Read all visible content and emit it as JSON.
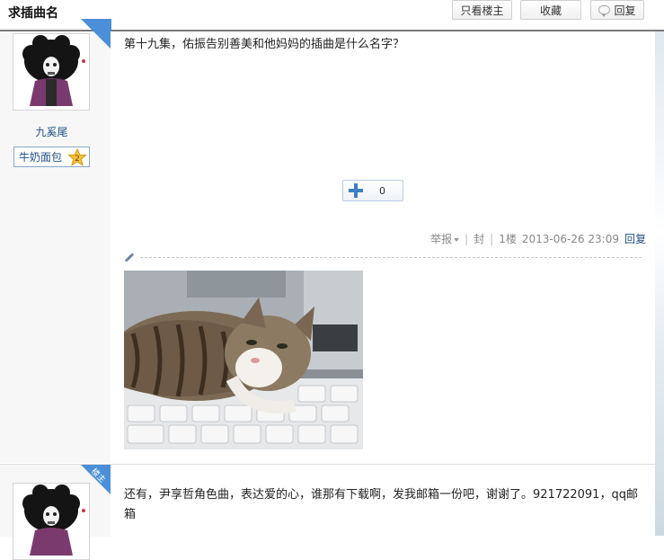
{
  "header": {
    "title": "求插曲名",
    "only_op_label": "只看楼主",
    "favorite_label": "收藏",
    "reply_label": "回复"
  },
  "posts": [
    {
      "username": "九奚尾",
      "op_tag": "楼主",
      "badge": "牛奶面包",
      "level": "2",
      "text": "第十九集，佑振告别善美和他妈妈的插曲是什么名字？",
      "like_count": "0",
      "report_label": "举报",
      "block_label": "封",
      "floor": "1楼",
      "datetime": "2013-06-26 23:09",
      "reply_label": "回复"
    },
    {
      "op_tag": "楼主",
      "text": "还有，尹享哲角色曲，表达爱的心，谁那有下载啊，发我邮箱一份吧，谢谢了。921722091，qq邮箱"
    }
  ],
  "colors": {
    "accent": "#4a8fd8",
    "link": "#1f4f86",
    "sidebar_bg": "#f7f7f7"
  }
}
